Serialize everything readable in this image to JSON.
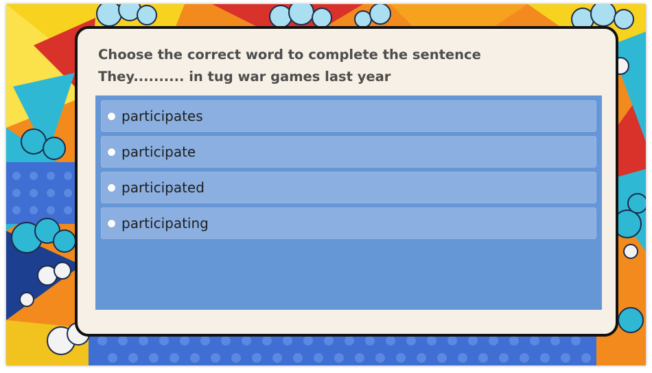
{
  "quiz": {
    "instruction": "Choose the correct word to complete the sentence",
    "sentence": "They.......... in tug war games last year",
    "options": [
      {
        "label": "participates"
      },
      {
        "label": "participate"
      },
      {
        "label": "participated"
      },
      {
        "label": "participating"
      }
    ]
  },
  "colors": {
    "card_background": "#f6f0e6",
    "answer_panel": "#6596d6",
    "option_background": "#8aafe0",
    "comic_blue": "#3f6fd3",
    "comic_orange": "#f28a1e",
    "comic_yellow": "#f7d21e",
    "comic_red": "#d8322b",
    "comic_teal": "#2eb8d4"
  }
}
